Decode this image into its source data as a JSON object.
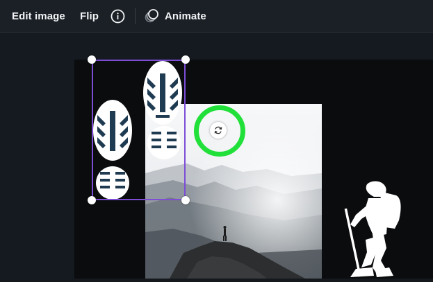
{
  "toolbar": {
    "edit_image_label": "Edit image",
    "flip_label": "Flip",
    "info_icon": "info-icon",
    "animate_label": "Animate",
    "animate_icon": "animate-icon"
  },
  "selection": {
    "handle_color": "#ffffff",
    "border_color": "#7d4dd6"
  },
  "rotate_control": {
    "icon": "rotate-icon",
    "highlight_color": "#22e03a"
  },
  "colors": {
    "toolbar_bg": "#1b2026",
    "canvas_bg": "#141a1f",
    "page_bg": "#0a0c0e"
  }
}
